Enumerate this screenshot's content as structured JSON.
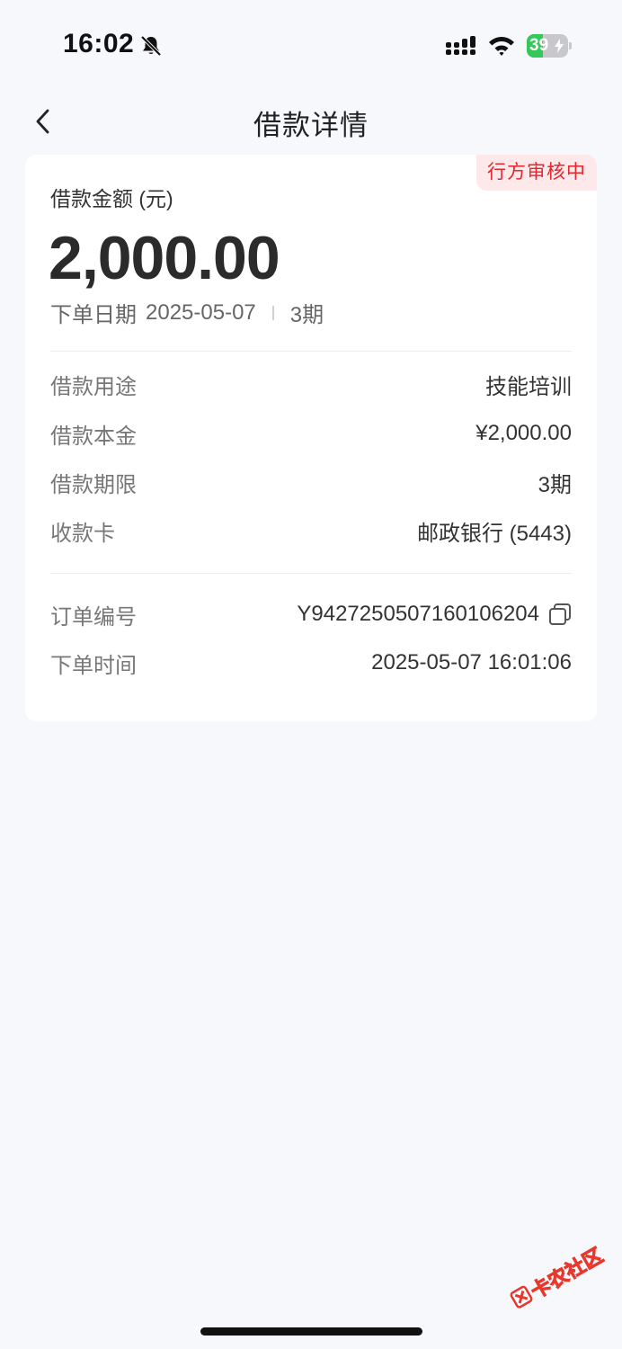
{
  "status_bar": {
    "time": "16:02",
    "battery_level": "39",
    "battery_fraction": 0.39,
    "icons": [
      "bell-slash-icon",
      "signal-icon",
      "wifi-icon",
      "battery-charging-icon"
    ]
  },
  "nav": {
    "title": "借款详情",
    "back_icon": "chevron-left-icon"
  },
  "loan": {
    "status_badge": "行方审核中",
    "amount_label": "借款金额 (元)",
    "amount": "2,000.00",
    "order_date_label": "下单日期",
    "order_date": "2025-05-07",
    "term_short": "3期",
    "details": [
      {
        "label": "借款用途",
        "value": "技能培训"
      },
      {
        "label": "借款本金",
        "value": "¥2,000.00"
      },
      {
        "label": "借款期限",
        "value": "3期"
      },
      {
        "label": "收款卡",
        "value": "邮政银行 (5443)"
      }
    ],
    "order_no_label": "订单编号",
    "order_no": "Y9427250507160106204",
    "order_time_label": "下单时间",
    "order_time": "2025-05-07 16:01:06"
  },
  "watermark": {
    "text": "卡农社区"
  },
  "colors": {
    "background": "#f7f8fc",
    "badge_bg": "#fde8ea",
    "badge_text": "#e5262d",
    "battery_green": "#34c759",
    "watermark_red": "#e8372c"
  }
}
